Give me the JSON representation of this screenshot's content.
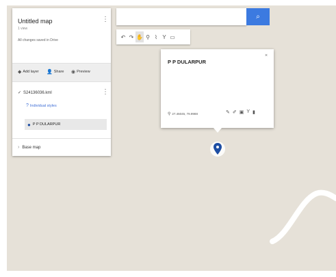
{
  "map": {
    "road_color": "#ffffff",
    "background_color": "#e6e1d8"
  },
  "panel": {
    "title": "Untitled map",
    "subtitle": "1 view",
    "saved_status": "All changes saved in Drive",
    "actions": {
      "add_layer": "Add layer",
      "share": "Share",
      "preview": "Preview"
    },
    "layer": {
      "name": "S24136036.kml",
      "styles_link": "Individual styles",
      "feature": "P P DULARPUR"
    },
    "base_map": "Base map"
  },
  "search": {
    "value": "",
    "placeholder": ""
  },
  "toolbar": {
    "tools": [
      "undo-icon",
      "redo-icon",
      "hand-icon",
      "marker-icon",
      "draw-line-icon",
      "directions-icon",
      "ruler-icon"
    ]
  },
  "info_window": {
    "title": "P P DULARPUR",
    "coordinates": "27.46045, 79.9988",
    "close_label": "×"
  },
  "colors": {
    "accent": "#3c7ae0",
    "marker": "#1e4ea3",
    "link": "#3f6ed6"
  }
}
